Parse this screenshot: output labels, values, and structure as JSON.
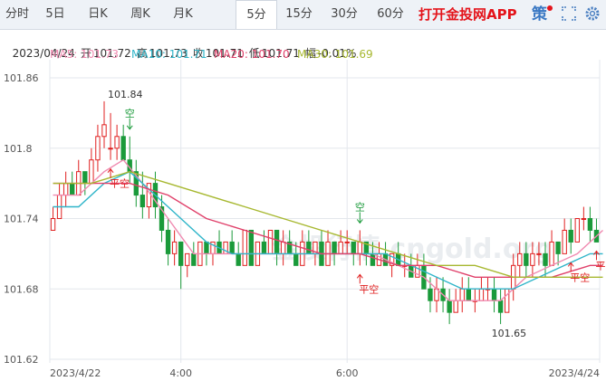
{
  "toolbar": {
    "tabs": [
      "分时",
      "5日",
      "日K",
      "周K",
      "月K",
      "5分",
      "15分",
      "30分",
      "60分"
    ],
    "active_tab": "5分",
    "brand_label": "打开金投网APP",
    "strategy_label": "策",
    "accent_color": "#e4141b"
  },
  "quote": {
    "date": "2023/04/24",
    "open_label": "开",
    "open": "101.72",
    "high_label": "高",
    "high": "101.73",
    "close_label": "收",
    "close": "101.71",
    "low_label": "低",
    "low": "101.71",
    "change_label": "幅",
    "change": "-0.01%"
  },
  "moving_averages": [
    {
      "label": "MA5: 101.73",
      "color": "#f08ab0"
    },
    {
      "label": "MA10: 101.71",
      "color": "#2fb5c9"
    },
    {
      "label": "MA20: 101.70",
      "color": "#e0406a"
    },
    {
      "label": "MA30: 101.69",
      "color": "#a7b830"
    }
  ],
  "watermark_text": "金投行情 cngold.org",
  "chart_data": {
    "type": "candlestick",
    "up_color": "#e02020",
    "down_color": "#1a9a3a",
    "ylim": [
      101.62,
      101.86
    ],
    "y_ticks": [
      "101.86",
      "101.8",
      "101.74",
      "101.68",
      "101.62"
    ],
    "y_tick_values": [
      101.86,
      101.8,
      101.74,
      101.68,
      101.62
    ],
    "x_tick_labels": [
      "2023/4/22",
      "4:00",
      "6:00",
      "2023/4/24"
    ],
    "x_tick_index": [
      3,
      20,
      46,
      85
    ],
    "annotations": {
      "max_label": "101.84",
      "max_index": 8,
      "min_label": "101.65",
      "min_index": 70,
      "signals": [
        {
          "text": "空",
          "index": 12,
          "type": "short"
        },
        {
          "text": "平空",
          "index": 9,
          "type": "close-short"
        },
        {
          "text": "空",
          "index": 48,
          "type": "short"
        },
        {
          "text": "平空",
          "index": 48,
          "type": "close-short"
        },
        {
          "text": "平空",
          "index": 81,
          "type": "close-short"
        },
        {
          "text": "平多",
          "index": 85,
          "type": "close-long"
        }
      ]
    },
    "candles": [
      [
        101.73,
        101.75,
        101.73,
        101.74
      ],
      [
        101.74,
        101.77,
        101.74,
        101.76
      ],
      [
        101.76,
        101.78,
        101.75,
        101.77
      ],
      [
        101.77,
        101.78,
        101.76,
        101.76
      ],
      [
        101.76,
        101.79,
        101.76,
        101.78
      ],
      [
        101.78,
        101.78,
        101.76,
        101.77
      ],
      [
        101.77,
        101.8,
        101.77,
        101.79
      ],
      [
        101.79,
        101.82,
        101.78,
        101.81
      ],
      [
        101.81,
        101.84,
        101.8,
        101.82
      ],
      [
        101.8,
        101.83,
        101.79,
        101.8
      ],
      [
        101.8,
        101.82,
        101.79,
        101.81
      ],
      [
        101.81,
        101.82,
        101.79,
        101.79
      ],
      [
        101.79,
        101.81,
        101.77,
        101.78
      ],
      [
        101.78,
        101.79,
        101.75,
        101.76
      ],
      [
        101.76,
        101.78,
        101.74,
        101.75
      ],
      [
        101.75,
        101.77,
        101.74,
        101.77
      ],
      [
        101.77,
        101.78,
        101.74,
        101.75
      ],
      [
        101.75,
        101.76,
        101.72,
        101.73
      ],
      [
        101.73,
        101.74,
        101.7,
        101.71
      ],
      [
        101.71,
        101.73,
        101.7,
        101.72
      ],
      [
        101.72,
        101.72,
        101.68,
        101.7
      ],
      [
        101.7,
        101.71,
        101.69,
        101.71
      ],
      [
        101.71,
        101.72,
        101.7,
        101.7
      ],
      [
        101.7,
        101.72,
        101.7,
        101.72
      ],
      [
        101.72,
        101.72,
        101.7,
        101.71
      ],
      [
        101.71,
        101.72,
        101.7,
        101.72
      ],
      [
        101.72,
        101.73,
        101.71,
        101.71
      ],
      [
        101.71,
        101.72,
        101.71,
        101.72
      ],
      [
        101.72,
        101.73,
        101.71,
        101.71
      ],
      [
        101.71,
        101.72,
        101.7,
        101.7
      ],
      [
        101.7,
        101.73,
        101.7,
        101.73
      ],
      [
        101.73,
        101.73,
        101.7,
        101.7
      ],
      [
        101.7,
        101.72,
        101.7,
        101.72
      ],
      [
        101.72,
        101.73,
        101.71,
        101.71
      ],
      [
        101.71,
        101.73,
        101.71,
        101.73
      ],
      [
        101.73,
        101.73,
        101.7,
        101.71
      ],
      [
        101.71,
        101.73,
        101.7,
        101.72
      ],
      [
        101.72,
        101.73,
        101.71,
        101.71
      ],
      [
        101.71,
        101.72,
        101.7,
        101.7
      ],
      [
        101.7,
        101.73,
        101.7,
        101.72
      ],
      [
        101.72,
        101.73,
        101.71,
        101.71
      ],
      [
        101.71,
        101.72,
        101.7,
        101.72
      ],
      [
        101.72,
        101.73,
        101.7,
        101.7
      ],
      [
        101.7,
        101.73,
        101.7,
        101.72
      ],
      [
        101.72,
        101.72,
        101.7,
        101.71
      ],
      [
        101.71,
        101.73,
        101.71,
        101.72
      ],
      [
        101.72,
        101.73,
        101.71,
        101.72
      ],
      [
        101.72,
        101.72,
        101.7,
        101.71
      ],
      [
        101.71,
        101.73,
        101.7,
        101.72
      ],
      [
        101.72,
        101.72,
        101.7,
        101.71
      ],
      [
        101.71,
        101.72,
        101.7,
        101.7
      ],
      [
        101.7,
        101.72,
        101.7,
        101.71
      ],
      [
        101.71,
        101.72,
        101.7,
        101.7
      ],
      [
        101.7,
        101.71,
        101.69,
        101.71
      ],
      [
        101.71,
        101.72,
        101.7,
        101.7
      ],
      [
        101.7,
        101.71,
        101.69,
        101.7
      ],
      [
        101.7,
        101.71,
        101.69,
        101.69
      ],
      [
        101.69,
        101.71,
        101.69,
        101.7
      ],
      [
        101.7,
        101.71,
        101.68,
        101.68
      ],
      [
        101.68,
        101.69,
        101.66,
        101.67
      ],
      [
        101.67,
        101.69,
        101.66,
        101.68
      ],
      [
        101.68,
        101.69,
        101.66,
        101.67
      ],
      [
        101.67,
        101.68,
        101.65,
        101.66
      ],
      [
        101.66,
        101.68,
        101.66,
        101.67
      ],
      [
        101.67,
        101.69,
        101.66,
        101.68
      ],
      [
        101.68,
        101.69,
        101.67,
        101.67
      ],
      [
        101.67,
        101.68,
        101.66,
        101.67
      ],
      [
        101.67,
        101.69,
        101.67,
        101.68
      ],
      [
        101.68,
        101.69,
        101.67,
        101.68
      ],
      [
        101.68,
        101.69,
        101.66,
        101.67
      ],
      [
        101.67,
        101.68,
        101.65,
        101.66
      ],
      [
        101.66,
        101.68,
        101.66,
        101.68
      ],
      [
        101.68,
        101.71,
        101.67,
        101.7
      ],
      [
        101.7,
        101.72,
        101.69,
        101.71
      ],
      [
        101.71,
        101.72,
        101.69,
        101.7
      ],
      [
        101.7,
        101.72,
        101.69,
        101.71
      ],
      [
        101.71,
        101.72,
        101.7,
        101.71
      ],
      [
        101.71,
        101.72,
        101.69,
        101.7
      ],
      [
        101.7,
        101.73,
        101.7,
        101.72
      ],
      [
        101.72,
        101.72,
        101.7,
        101.71
      ],
      [
        101.71,
        101.74,
        101.71,
        101.73
      ],
      [
        101.73,
        101.74,
        101.71,
        101.72
      ],
      [
        101.72,
        101.74,
        101.72,
        101.74
      ],
      [
        101.74,
        101.75,
        101.73,
        101.74
      ],
      [
        101.74,
        101.75,
        101.72,
        101.73
      ],
      [
        101.73,
        101.74,
        101.72,
        101.72
      ]
    ],
    "series": [
      {
        "name": "MA5",
        "color": "#f08ab0",
        "points": [
          [
            0,
            101.76
          ],
          [
            4,
            101.76
          ],
          [
            8,
            101.78
          ],
          [
            11,
            101.79
          ],
          [
            14,
            101.77
          ],
          [
            18,
            101.74
          ],
          [
            22,
            101.71
          ],
          [
            26,
            101.71
          ],
          [
            32,
            101.71
          ],
          [
            38,
            101.71
          ],
          [
            44,
            101.71
          ],
          [
            50,
            101.71
          ],
          [
            54,
            101.7
          ],
          [
            58,
            101.69
          ],
          [
            62,
            101.67
          ],
          [
            66,
            101.67
          ],
          [
            70,
            101.67
          ],
          [
            74,
            101.69
          ],
          [
            78,
            101.7
          ],
          [
            82,
            101.71
          ],
          [
            86,
            101.73
          ]
        ]
      },
      {
        "name": "MA10",
        "color": "#2fb5c9",
        "points": [
          [
            0,
            101.75
          ],
          [
            4,
            101.75
          ],
          [
            8,
            101.77
          ],
          [
            12,
            101.78
          ],
          [
            16,
            101.76
          ],
          [
            20,
            101.74
          ],
          [
            24,
            101.72
          ],
          [
            28,
            101.71
          ],
          [
            34,
            101.71
          ],
          [
            40,
            101.71
          ],
          [
            46,
            101.71
          ],
          [
            52,
            101.71
          ],
          [
            56,
            101.7
          ],
          [
            60,
            101.69
          ],
          [
            64,
            101.68
          ],
          [
            68,
            101.68
          ],
          [
            72,
            101.68
          ],
          [
            76,
            101.69
          ],
          [
            80,
            101.7
          ],
          [
            84,
            101.71
          ],
          [
            86,
            101.71
          ]
        ]
      },
      {
        "name": "MA20",
        "color": "#e0406a",
        "points": [
          [
            0,
            101.77
          ],
          [
            6,
            101.77
          ],
          [
            12,
            101.77
          ],
          [
            18,
            101.76
          ],
          [
            24,
            101.74
          ],
          [
            30,
            101.73
          ],
          [
            36,
            101.72
          ],
          [
            42,
            101.71
          ],
          [
            48,
            101.71
          ],
          [
            54,
            101.7
          ],
          [
            60,
            101.7
          ],
          [
            66,
            101.69
          ],
          [
            72,
            101.69
          ],
          [
            78,
            101.69
          ],
          [
            84,
            101.7
          ],
          [
            86,
            101.7
          ]
        ]
      },
      {
        "name": "MA30",
        "color": "#a7b830",
        "points": [
          [
            0,
            101.77
          ],
          [
            6,
            101.77
          ],
          [
            12,
            101.78
          ],
          [
            18,
            101.77
          ],
          [
            24,
            101.76
          ],
          [
            30,
            101.75
          ],
          [
            36,
            101.74
          ],
          [
            42,
            101.73
          ],
          [
            48,
            101.72
          ],
          [
            54,
            101.71
          ],
          [
            60,
            101.7
          ],
          [
            66,
            101.7
          ],
          [
            72,
            101.69
          ],
          [
            78,
            101.69
          ],
          [
            84,
            101.69
          ],
          [
            86,
            101.69
          ]
        ]
      }
    ]
  }
}
